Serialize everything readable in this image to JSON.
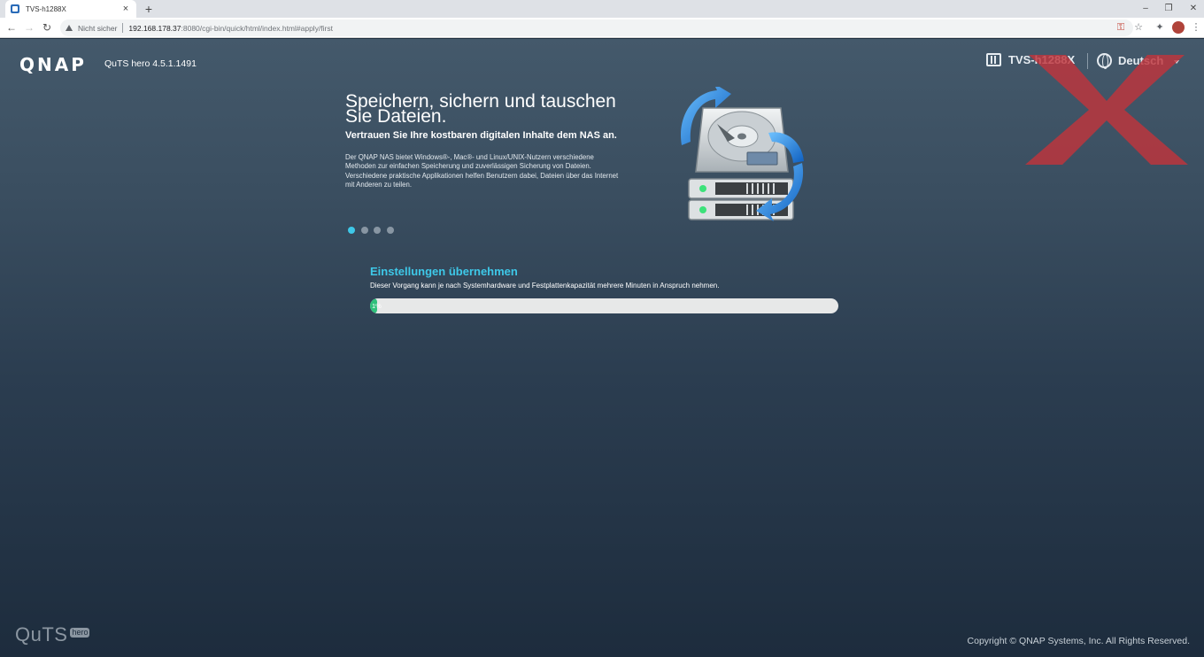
{
  "browser": {
    "tab_title": "TVS-h1288X",
    "tab_close": "×",
    "new_tab": "+",
    "window_controls": {
      "minimize": "–",
      "maximize": "❐",
      "close": "✕"
    },
    "nav": {
      "back": "←",
      "forward": "→",
      "reload": "↻"
    },
    "security_label": "Nicht sicher",
    "url_host": "192.168.178.37",
    "url_rest": ":8080/cgi-bin/quick/html/index.html#apply/first",
    "star_icon": "☆"
  },
  "header": {
    "logo": "QNAP",
    "version": "QuTS hero 4.5.1.1491",
    "device_name": "TVS-h1288X",
    "language": "Deutsch"
  },
  "slide": {
    "headline": "Speichern, sichern und tauschen Sie Dateien.",
    "subheadline": "Vertrauen Sie Ihre kostbaren digitalen Inhalte dem NAS an.",
    "description": "Der QNAP NAS bietet Windows®-, Mac®- und Linux/UNIX-Nutzern verschiedene Methoden zur einfachen Speicherung und zuverlässigen Sicherung von Dateien. Verschiedene praktische Applikationen helfen Benutzern dabei, Dateien über das Internet mit Anderen zu teilen.",
    "dot_count": 4,
    "active_dot": 0
  },
  "progress": {
    "title": "Einstellungen übernehmen",
    "description": "Dieser Vorgang kann je nach Systemhardware und Festplattenkapazität mehrere Minuten in Anspruch nehmen.",
    "percent": 1,
    "percent_label": "1%"
  },
  "footer": {
    "logo_main": "QuTS",
    "logo_sub": "hero",
    "copyright": "Copyright © QNAP Systems, Inc. All Rights Reserved."
  },
  "colors": {
    "accent": "#3ec8e8",
    "progress_fill": "#2fc07b",
    "progress_track": "#e7e8e8"
  }
}
